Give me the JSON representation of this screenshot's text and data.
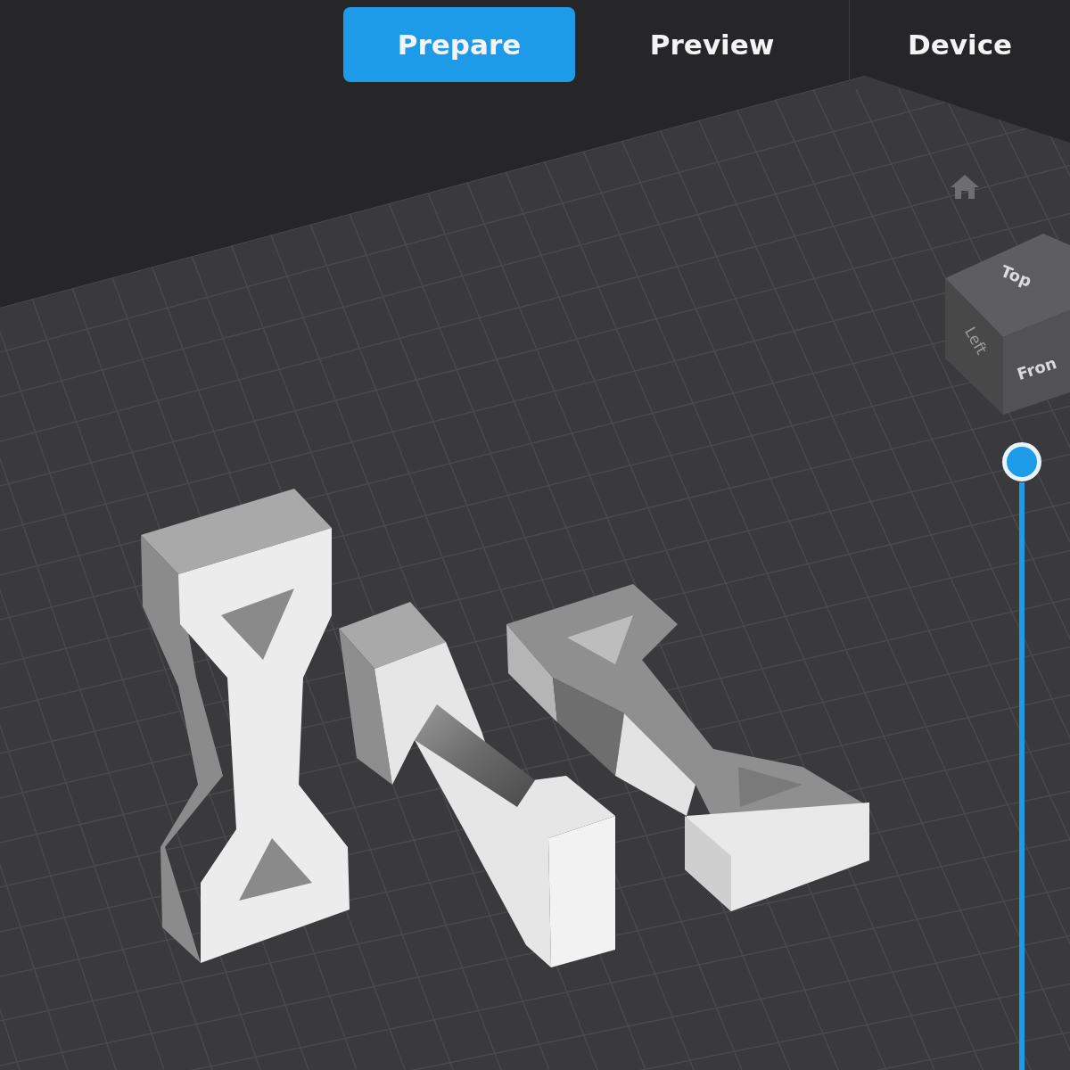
{
  "tabs": [
    {
      "label": "Prepare",
      "selected": true
    },
    {
      "label": "Preview",
      "selected": false
    },
    {
      "label": "Device",
      "selected": false
    }
  ],
  "view_cube": {
    "top": "Top",
    "left": "Left",
    "front": "Fron"
  },
  "layer_slider": {
    "level": 1
  }
}
